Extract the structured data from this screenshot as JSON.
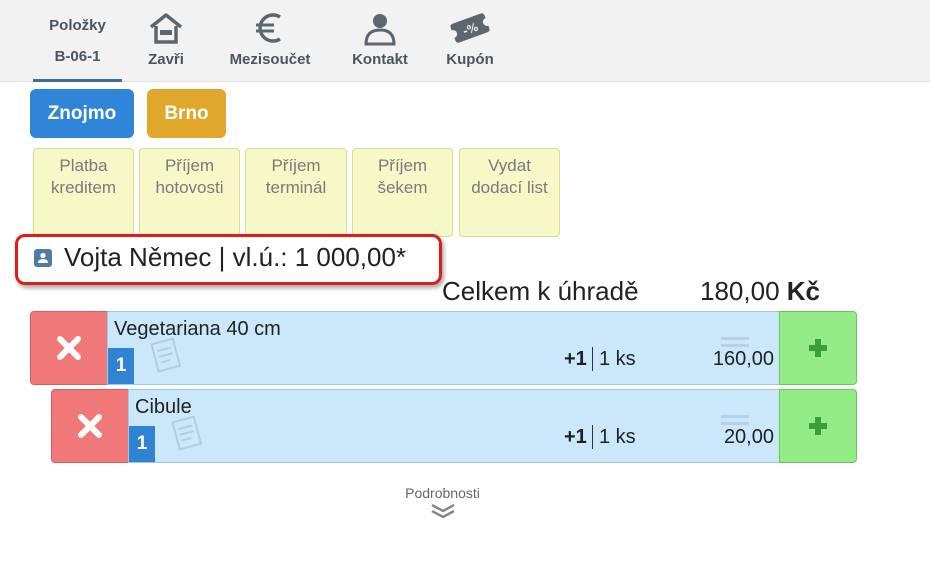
{
  "nav": {
    "active_tab": {
      "line1": "Položky",
      "line2": "B-06-1"
    },
    "tabs": [
      {
        "label": "Zavři",
        "icon": "home-icon"
      },
      {
        "label": "Mezisoučet",
        "icon": "euro-icon"
      },
      {
        "label": "Kontakt",
        "icon": "user-icon"
      },
      {
        "label": "Kupón",
        "icon": "coupon-icon"
      }
    ]
  },
  "branches": [
    {
      "label": "Znojmo",
      "color": "#2f86d8"
    },
    {
      "label": "Brno",
      "color": "#e0a72c"
    }
  ],
  "payments": [
    {
      "line1": "Platba",
      "line2": "kreditem"
    },
    {
      "line1": "Příjem",
      "line2": "hotovosti"
    },
    {
      "line1": "Příjem",
      "line2": "terminál"
    },
    {
      "line1": "Příjem",
      "line2": "šekem"
    },
    {
      "line1": "Vydat",
      "line2": "dodací list"
    }
  ],
  "customer": {
    "text": "Vojta Němec | vl.ú.: 1 000,00*"
  },
  "total": {
    "label": "Celkem k úhradě",
    "amount": "180,00",
    "currency": "Kč"
  },
  "items": [
    {
      "name": "Vegetariana 40 cm",
      "qty": "1",
      "increment": "+1",
      "unit_qty": "1 ks",
      "price": "160,00"
    },
    {
      "name": "Cibule",
      "qty": "1",
      "increment": "+1",
      "unit_qty": "1 ks",
      "price": "20,00"
    }
  ],
  "details": {
    "label": "Podrobnosti"
  }
}
